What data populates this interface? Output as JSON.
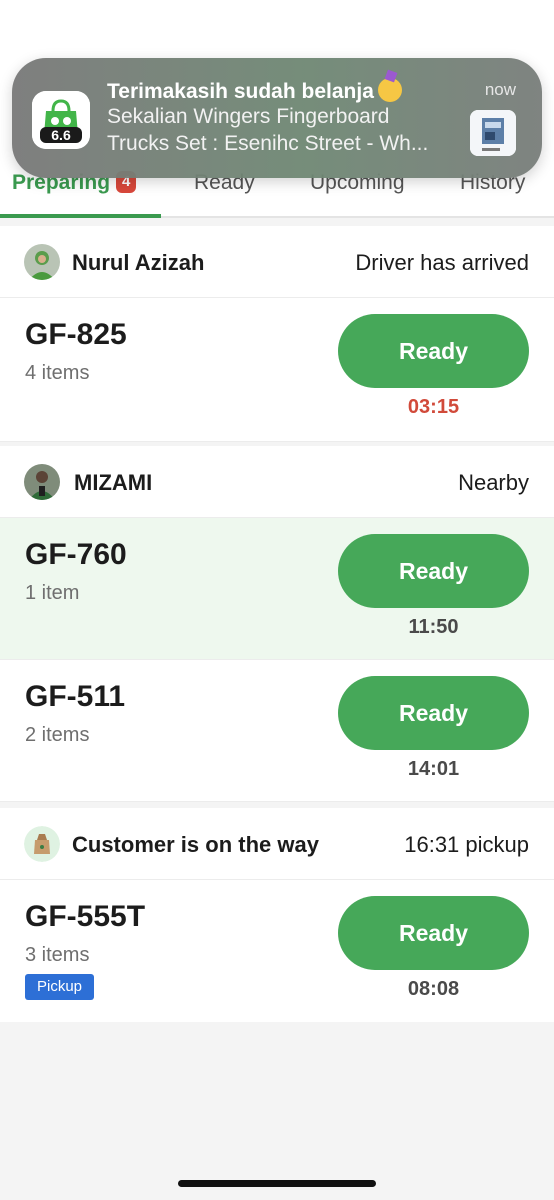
{
  "tabs": [
    {
      "label": "Preparing",
      "badge": "4"
    },
    {
      "label": "Ready"
    },
    {
      "label": "Upcoming"
    },
    {
      "label": "History"
    }
  ],
  "notification": {
    "title": "Terimakasih sudah belanja",
    "line1": "Sekalian Wingers Fingerboard",
    "line2": "Trucks Set : Esenihc Street - Wh...",
    "time": "now",
    "app_icon_text": "6.6"
  },
  "groups": [
    {
      "name": "Nurul Azizah",
      "status": "Driver has arrived",
      "orders": [
        {
          "id": "GF-825",
          "items": "4 items",
          "button": "Ready",
          "timer": "03:15"
        }
      ]
    },
    {
      "name": "MIZAMI",
      "status": "Nearby",
      "orders": [
        {
          "id": "GF-760",
          "items": "1 item",
          "button": "Ready",
          "timer": "11:50"
        },
        {
          "id": "GF-511",
          "items": "2 items",
          "button": "Ready",
          "timer": "14:01"
        }
      ]
    },
    {
      "name": "Customer is on the way",
      "status": "16:31 pickup",
      "orders": [
        {
          "id": "GF-555T",
          "items": "3 items",
          "button": "Ready",
          "timer": "08:08",
          "tag": "Pickup"
        }
      ]
    }
  ],
  "colors": {
    "accent": "#46a859",
    "urgent": "#d14a3a",
    "badge": "#d9483b",
    "pickup_tag": "#2d6fd6"
  }
}
